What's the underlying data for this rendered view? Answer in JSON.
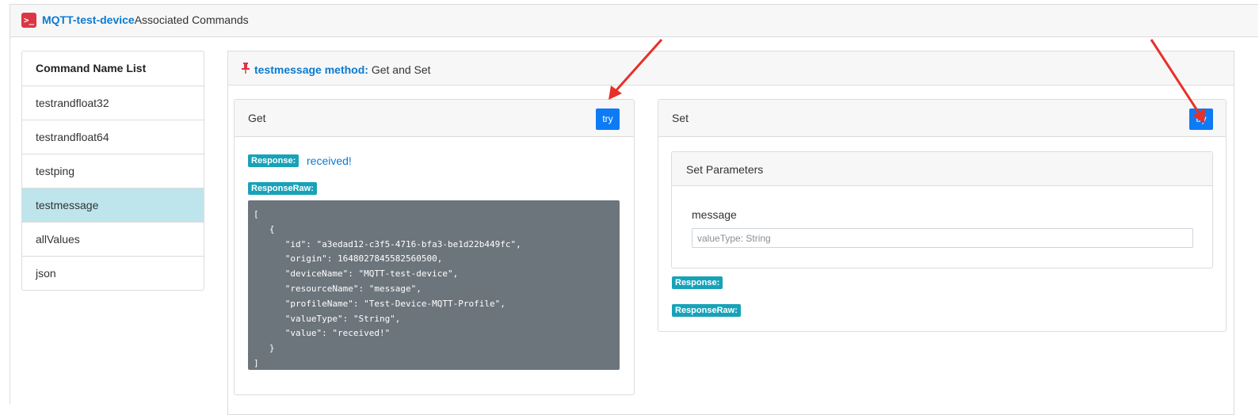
{
  "header": {
    "icon": "terminal-icon",
    "device_name": "MQTT-test-device",
    "suffix": "Associated Commands"
  },
  "command_list": {
    "title": "Command Name List",
    "items": [
      {
        "label": "testrandfloat32",
        "active": false
      },
      {
        "label": "testrandfloat64",
        "active": false
      },
      {
        "label": "testping",
        "active": false
      },
      {
        "label": "testmessage",
        "active": true
      },
      {
        "label": "allValues",
        "active": false
      },
      {
        "label": "json",
        "active": false
      }
    ]
  },
  "method": {
    "icon": "pin-icon",
    "name": "testmessage method:",
    "mode": "Get and Set"
  },
  "get_panel": {
    "title": "Get",
    "try_label": "try",
    "response_label": "Response:",
    "response_value": "received!",
    "response_raw_label": "ResponseRaw:",
    "response_raw": "[\n   {\n      \"id\": \"a3edad12-c3f5-4716-bfa3-be1d22b449fc\",\n      \"origin\": 1648027845582560500,\n      \"deviceName\": \"MQTT-test-device\",\n      \"resourceName\": \"message\",\n      \"profileName\": \"Test-Device-MQTT-Profile\",\n      \"valueType\": \"String\",\n      \"value\": \"received!\"\n   }\n]"
  },
  "set_panel": {
    "title": "Set",
    "try_label": "try",
    "params_title": "Set Parameters",
    "param_name": "message",
    "param_placeholder": "valueType: String",
    "response_label": "Response:",
    "response_raw_label": "ResponseRaw:"
  },
  "colors": {
    "accent": "#0b7ad1",
    "button": "#0d7bf5",
    "badge": "#17a2b8",
    "active_row": "#bee5eb",
    "code_bg": "#6c747c",
    "arrow": "#e8302a"
  }
}
